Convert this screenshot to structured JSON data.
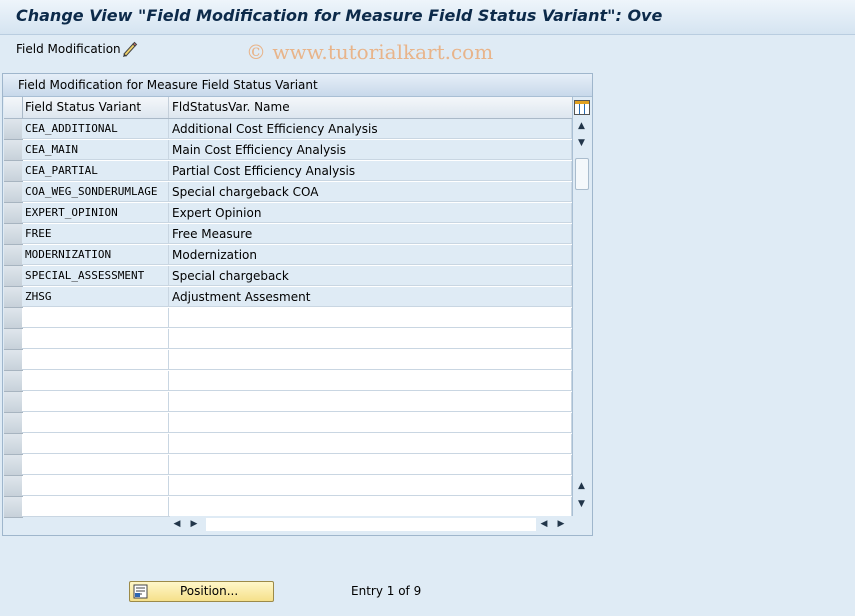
{
  "window": {
    "title": "Change View \"Field Modification for Measure Field Status Variant\": Ove"
  },
  "toolbar": {
    "field_modification_label": "Field Modification",
    "watermark": "© www.tutorialkart.com"
  },
  "panel": {
    "title": "Field Modification for Measure Field Status Variant"
  },
  "table": {
    "columns": [
      "Field Status Variant",
      "FldStatusVar. Name"
    ],
    "rows": [
      {
        "variant": "CEA_ADDITIONAL",
        "name": "Additional Cost Efficiency Analysis"
      },
      {
        "variant": "CEA_MAIN",
        "name": "Main Cost Efficiency Analysis"
      },
      {
        "variant": "CEA_PARTIAL",
        "name": "Partial Cost Efficiency Analysis"
      },
      {
        "variant": "COA_WEG_SONDERUMLAGE",
        "name": "Special chargeback COA"
      },
      {
        "variant": "EXPERT_OPINION",
        "name": "Expert Opinion"
      },
      {
        "variant": "FREE",
        "name": "Free Measure"
      },
      {
        "variant": "MODERNIZATION",
        "name": "Modernization"
      },
      {
        "variant": "SPECIAL_ASSESSMENT",
        "name": "Special chargeback"
      },
      {
        "variant": "ZHSG",
        "name": "Adjustment Assesment"
      },
      {
        "variant": "",
        "name": ""
      },
      {
        "variant": "",
        "name": ""
      },
      {
        "variant": "",
        "name": ""
      },
      {
        "variant": "",
        "name": ""
      },
      {
        "variant": "",
        "name": ""
      },
      {
        "variant": "",
        "name": ""
      },
      {
        "variant": "",
        "name": ""
      },
      {
        "variant": "",
        "name": ""
      },
      {
        "variant": "",
        "name": ""
      },
      {
        "variant": "",
        "name": ""
      }
    ]
  },
  "footer": {
    "position_button_label": "Position...",
    "entry_info": "Entry 1 of 9"
  }
}
